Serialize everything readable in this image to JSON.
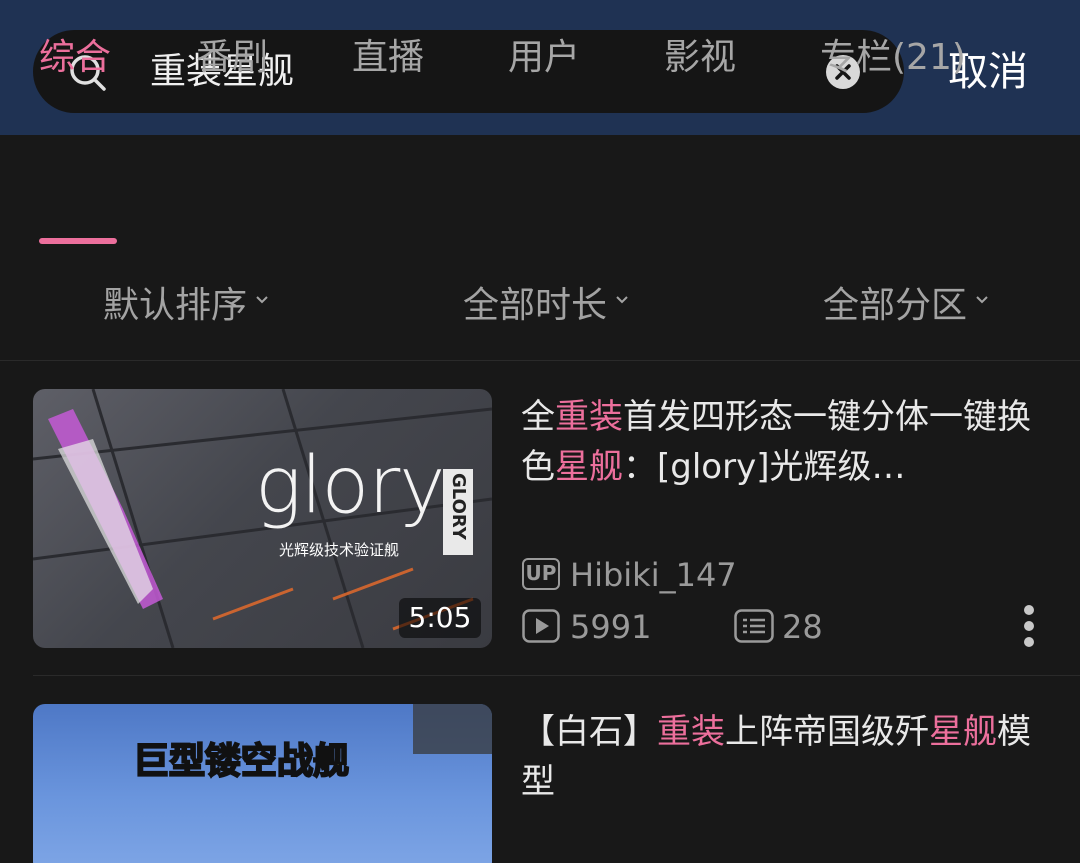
{
  "search": {
    "query": "重装星舰",
    "cancel_label": "取消"
  },
  "tabs": [
    {
      "label": "综合",
      "active": true
    },
    {
      "label": "番剧",
      "active": false
    },
    {
      "label": "直播",
      "active": false
    },
    {
      "label": "用户",
      "active": false
    },
    {
      "label": "影视",
      "active": false
    },
    {
      "label": "专栏(21)",
      "active": false
    }
  ],
  "filters": [
    {
      "label": "默认排序"
    },
    {
      "label": "全部时长"
    },
    {
      "label": "全部分区"
    }
  ],
  "videos": [
    {
      "title_parts": [
        {
          "text": "全",
          "highlight": false
        },
        {
          "text": "重装",
          "highlight": true
        },
        {
          "text": "首发四形态一键分体一键换色",
          "highlight": false
        },
        {
          "text": "星舰",
          "highlight": true
        },
        {
          "text": "：[glory]光辉级…",
          "highlight": false
        }
      ],
      "duration": "5:05",
      "uploader_badge": "UP",
      "uploader": "Hibiki_147",
      "views": "5991",
      "comments": "28",
      "thumbnail_text": {
        "main": "glory",
        "subtitle": "光辉级技术验证舰",
        "vertical": "GLORY"
      }
    },
    {
      "title_parts": [
        {
          "text": "【白石】",
          "highlight": false
        },
        {
          "text": "重装",
          "highlight": true
        },
        {
          "text": "上阵帝国级歼",
          "highlight": false
        },
        {
          "text": "星舰",
          "highlight": true
        },
        {
          "text": "模型",
          "highlight": false
        }
      ],
      "thumbnail_text": {
        "main": "巨型镂空战舰"
      }
    }
  ],
  "colors": {
    "accent": "#ec6f9c",
    "topbar": "#1f3253",
    "background": "#181818"
  }
}
